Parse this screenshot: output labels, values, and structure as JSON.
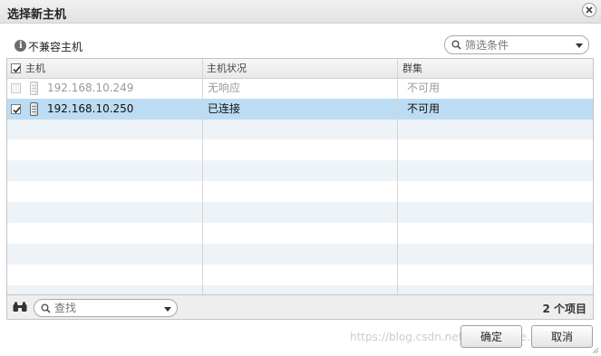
{
  "dialog": {
    "title": "选择新主机",
    "close_icon": "close-icon"
  },
  "toolbar": {
    "incompatible_label": "不兼容主机",
    "info_icon": "info-icon",
    "filter_placeholder": "筛选条件"
  },
  "grid": {
    "columns": [
      "主机",
      "主机状况",
      "群集"
    ],
    "rows": [
      {
        "checked": false,
        "disabled": true,
        "host": "192.168.10.249",
        "status": "无响应",
        "cluster": "不可用"
      },
      {
        "checked": true,
        "disabled": false,
        "host": "192.168.10.250",
        "status": "已连接",
        "cluster": "不可用"
      }
    ]
  },
  "footer": {
    "find_placeholder": "查找",
    "item_count": "2 个项目"
  },
  "buttons": {
    "ok": "确定",
    "cancel": "取消"
  },
  "watermark": "https://blog.csdn.net/... software... ing",
  "colors": {
    "selected_row": "#bcdcf4",
    "alt_row": "#eef3f8",
    "dim_text": "#9a9a9a"
  }
}
